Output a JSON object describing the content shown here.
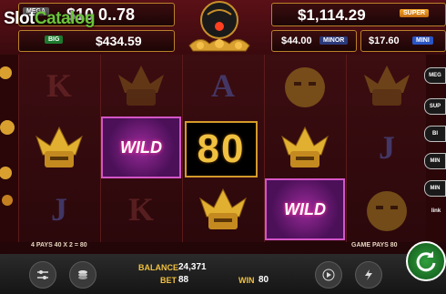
{
  "app": {
    "watermark_prefix": "Slot",
    "watermark_suffix": "Catalog"
  },
  "jackpots": {
    "mega": {
      "tag": "MEGA",
      "value": "$10 0..78"
    },
    "big": {
      "tag": "BIG",
      "value": "$434.59"
    },
    "super": {
      "tag": "SUPER",
      "value": "$1,114.29"
    },
    "minor": {
      "tag": "MINOR",
      "value": "$44.00"
    },
    "mini": {
      "tag": "MINI",
      "value": "$17.60"
    }
  },
  "reels": {
    "columns": [
      [
        "K",
        "helmet",
        "J"
      ],
      [
        "helmet",
        "WILD",
        "K"
      ],
      [
        "A",
        "80",
        "helmet"
      ],
      [
        "helmet",
        "helmet",
        "WILD"
      ],
      [
        "helmet",
        "J",
        "helmet"
      ]
    ],
    "win_banner": "80"
  },
  "side_right": {
    "labels": [
      "MEG",
      "SUP",
      "BI",
      "MIN",
      "MIN",
      "link"
    ]
  },
  "info": {
    "pays_left": "4 PAYS 40 X 2 = 80",
    "pays_right": "GAME PAYS 80"
  },
  "bottom": {
    "balance_label": "BALANCE",
    "balance_value": "24,371",
    "bet_label": "BET",
    "bet_value": "88",
    "win_label": "WIN",
    "win_value": "80"
  },
  "colors": {
    "accent_gold": "#f0c040",
    "spin_green": "#2fa03c",
    "wild_pink": "#d455c7"
  }
}
